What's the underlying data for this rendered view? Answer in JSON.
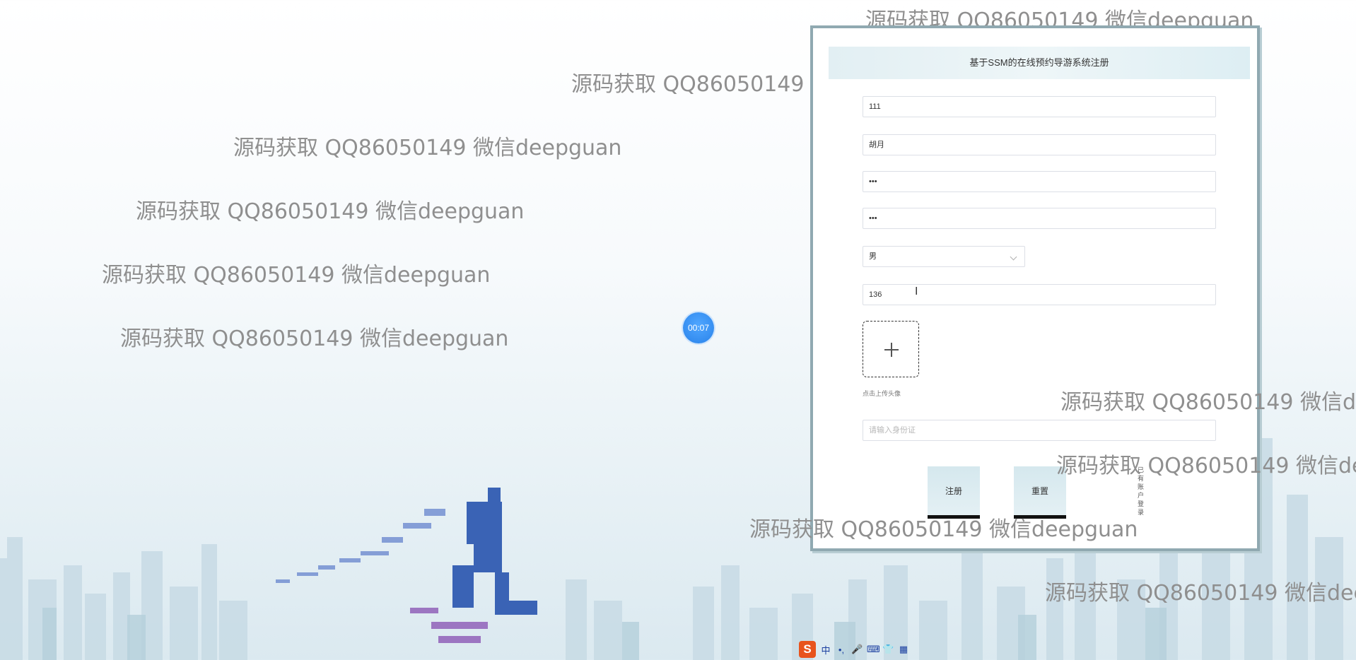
{
  "watermark": "源码获取 QQ86050149 微信deepguan",
  "form": {
    "title": "基于SSM的在线预约导游系统注册",
    "account_value": "111",
    "name_value": "胡月",
    "password_value": "•••",
    "confirm_password_value": "•••",
    "gender_value": "男",
    "phone_value": "136",
    "upload_label": "点击上传头像",
    "id_card_placeholder": "请输入身份证",
    "register_label": "注册",
    "reset_label": "重置",
    "login_link": "已有账户登录"
  },
  "timer": {
    "value": "00:07"
  },
  "ime": {
    "logo": "S",
    "mode": "中",
    "items": [
      "•,",
      "🎤",
      "⌨",
      "👕",
      "▦"
    ]
  }
}
